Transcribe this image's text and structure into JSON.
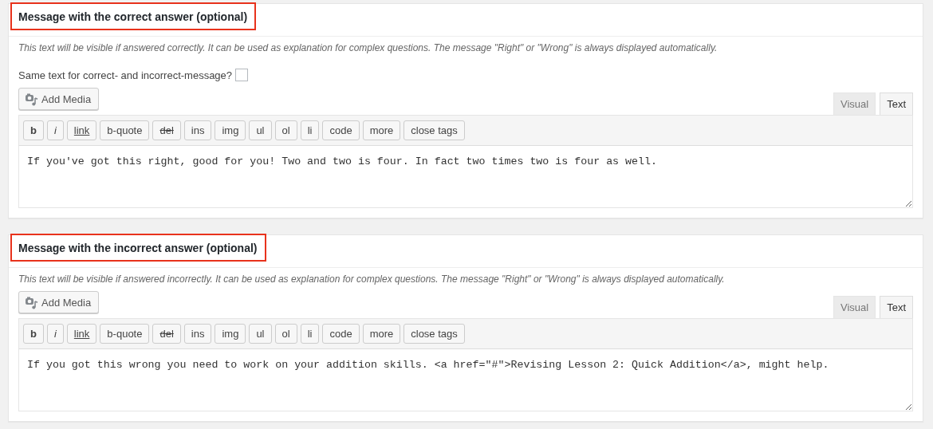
{
  "sections": [
    {
      "title": "Message with the correct answer (optional)",
      "title_highlighted": true,
      "description": "This text will be visible if answered correctly. It can be used as explanation for complex questions. The message \"Right\" or \"Wrong\" is always displayed automatically.",
      "same_text_option": {
        "label": "Same text for correct- and incorrect-message?",
        "checked": false
      },
      "add_media": "Add Media",
      "tabs": [
        {
          "label": "Visual",
          "selected": false
        },
        {
          "label": "Text",
          "selected": true
        }
      ],
      "toolbar": [
        {
          "label": "b",
          "kind": "bold"
        },
        {
          "label": "i",
          "kind": "italic"
        },
        {
          "label": "link",
          "kind": "underline"
        },
        {
          "label": "b-quote",
          "kind": "plain"
        },
        {
          "label": "del",
          "kind": "strike"
        },
        {
          "label": "ins",
          "kind": "plain"
        },
        {
          "label": "img",
          "kind": "plain"
        },
        {
          "label": "ul",
          "kind": "plain"
        },
        {
          "label": "ol",
          "kind": "plain"
        },
        {
          "label": "li",
          "kind": "plain"
        },
        {
          "label": "code",
          "kind": "plain"
        },
        {
          "label": "more",
          "kind": "plain"
        },
        {
          "label": "close tags",
          "kind": "plain"
        }
      ],
      "content": "If you've got this right, good for you! Two and two is four. In fact two times two is four as well."
    },
    {
      "title": "Message with the incorrect answer (optional)",
      "title_highlighted": true,
      "description": "This text will be visible if answered incorrectly. It can be used as explanation for complex questions. The message \"Right\" or \"Wrong\" is always displayed automatically.",
      "add_media": "Add Media",
      "tabs": [
        {
          "label": "Visual",
          "selected": false
        },
        {
          "label": "Text",
          "selected": true
        }
      ],
      "toolbar": [
        {
          "label": "b",
          "kind": "bold"
        },
        {
          "label": "i",
          "kind": "italic"
        },
        {
          "label": "link",
          "kind": "underline"
        },
        {
          "label": "b-quote",
          "kind": "plain"
        },
        {
          "label": "del",
          "kind": "strike"
        },
        {
          "label": "ins",
          "kind": "plain"
        },
        {
          "label": "img",
          "kind": "plain"
        },
        {
          "label": "ul",
          "kind": "plain"
        },
        {
          "label": "ol",
          "kind": "plain"
        },
        {
          "label": "li",
          "kind": "plain"
        },
        {
          "label": "code",
          "kind": "plain"
        },
        {
          "label": "more",
          "kind": "plain"
        },
        {
          "label": "close tags",
          "kind": "plain"
        }
      ],
      "content": "If you got this wrong you need to work on your addition skills. <a href=\"#\">Revising Lesson 2: Quick Addition</a>, might help."
    }
  ]
}
